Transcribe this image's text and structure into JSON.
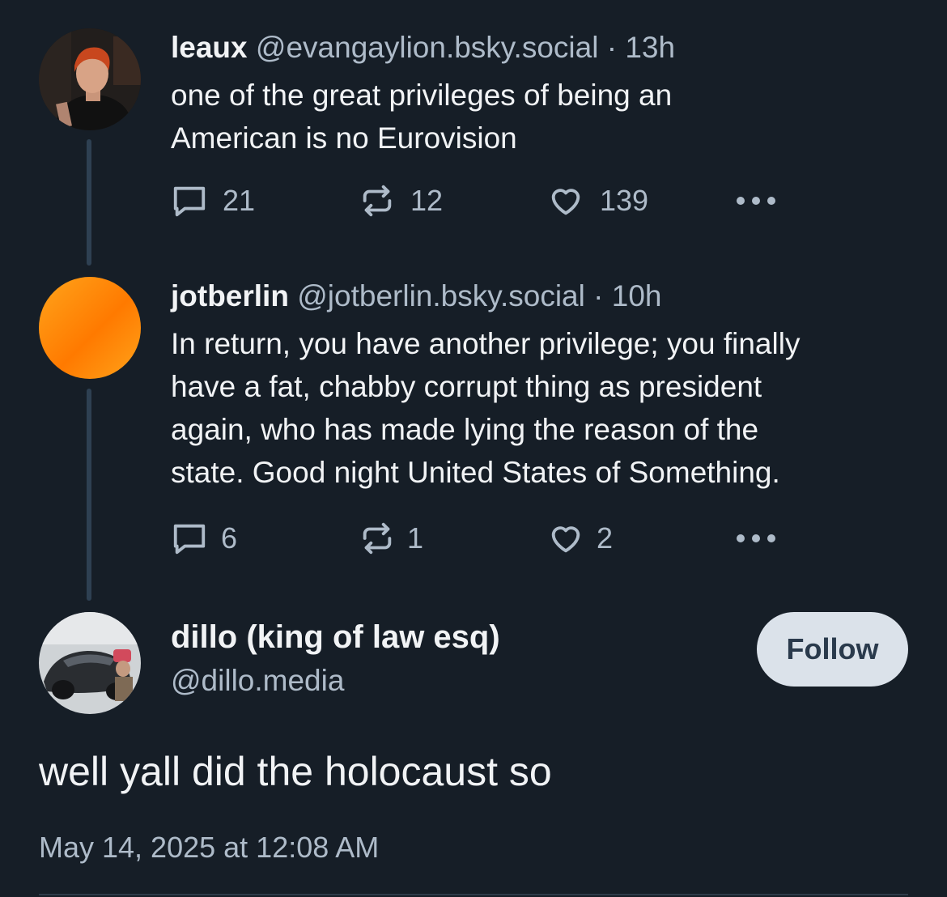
{
  "posts": [
    {
      "name": "leaux",
      "handle": "@evangaylion.bsky.social",
      "separator": "·",
      "time": "13h",
      "text_lines": [
        "one of the great privileges of being an",
        "American is no Eurovision"
      ],
      "replies": "21",
      "reposts": "12",
      "likes": "139",
      "avatar_icon": "person-photo-avatar"
    },
    {
      "name": "jotberlin",
      "handle": "@jotberlin.bsky.social",
      "separator": "·",
      "time": "10h",
      "text_lines": [
        "In return, you have another privilege; you finally",
        "have a fat, chabby corrupt thing as president",
        "again, who has made lying the reason of the",
        "state. Good night United States of Something."
      ],
      "replies": "6",
      "reposts": "1",
      "likes": "2",
      "avatar_icon": "orange-gradient-avatar"
    }
  ],
  "main_post": {
    "name": "dillo (king of law esq)",
    "handle": "@dillo.media",
    "follow_label": "Follow",
    "text": "well yall did the holocaust so",
    "date": "May 14, 2025 at 12:08 AM",
    "avatar_icon": "car-photo-avatar"
  },
  "icons": {
    "reply": "reply-icon",
    "repost": "repost-icon",
    "like": "heart-icon",
    "more": "more-options-icon"
  },
  "colors": {
    "background": "#161e27",
    "text_primary": "#f1f3f5",
    "text_secondary": "#aebbc9",
    "thread_line": "#2e4052",
    "follow_button": "#dbe2ea"
  }
}
